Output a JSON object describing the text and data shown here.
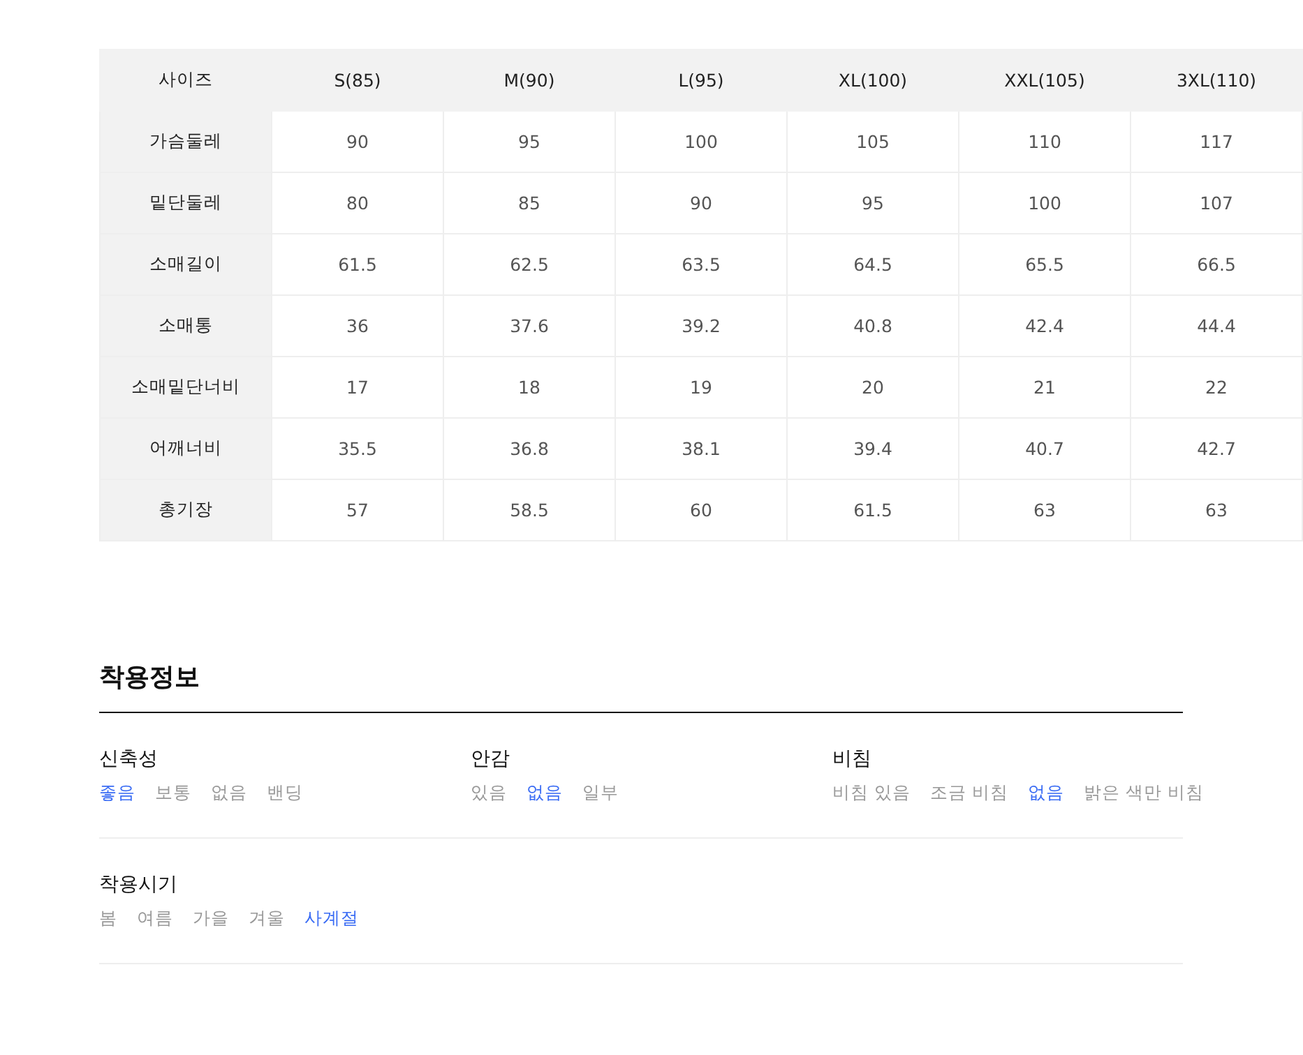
{
  "size_table": {
    "columns": [
      "사이즈",
      "S(85)",
      "M(90)",
      "L(95)",
      "XL(100)",
      "XXL(105)",
      "3XL(110)"
    ],
    "rows": [
      {
        "cells": [
          "가슴둘레",
          "90",
          "95",
          "100",
          "105",
          "110",
          "117"
        ]
      },
      {
        "cells": [
          "밑단둘레",
          "80",
          "85",
          "90",
          "95",
          "100",
          "107"
        ]
      },
      {
        "cells": [
          "소매길이",
          "61.5",
          "62.5",
          "63.5",
          "64.5",
          "65.5",
          "66.5"
        ]
      },
      {
        "cells": [
          "소매통",
          "36",
          "37.6",
          "39.2",
          "40.8",
          "42.4",
          "44.4"
        ]
      },
      {
        "cells": [
          "소매밑단너비",
          "17",
          "18",
          "19",
          "20",
          "21",
          "22"
        ]
      },
      {
        "cells": [
          "어깨너비",
          "35.5",
          "36.8",
          "38.1",
          "39.4",
          "40.7",
          "42.7"
        ]
      },
      {
        "cells": [
          "총기장",
          "57",
          "58.5",
          "60",
          "61.5",
          "63",
          "63"
        ]
      }
    ]
  },
  "fit_info": {
    "title": "착용정보",
    "sections": [
      {
        "groups": [
          {
            "label": "신축성",
            "options": [
              {
                "text": "좋음",
                "selected": true
              },
              {
                "text": "보통",
                "selected": false
              },
              {
                "text": "없음",
                "selected": false
              },
              {
                "text": "밴딩",
                "selected": false
              }
            ]
          },
          {
            "label": "안감",
            "options": [
              {
                "text": "있음",
                "selected": false
              },
              {
                "text": "없음",
                "selected": true
              },
              {
                "text": "일부",
                "selected": false
              }
            ]
          },
          {
            "label": "비침",
            "options": [
              {
                "text": "비침 있음",
                "selected": false
              },
              {
                "text": "조금 비침",
                "selected": false
              },
              {
                "text": "없음",
                "selected": true
              },
              {
                "text": "밝은 색만 비침",
                "selected": false
              }
            ]
          }
        ]
      },
      {
        "groups": [
          {
            "label": "착용시기",
            "options": [
              {
                "text": "봄",
                "selected": false
              },
              {
                "text": "여름",
                "selected": false
              },
              {
                "text": "가을",
                "selected": false
              },
              {
                "text": "겨울",
                "selected": false
              },
              {
                "text": "사계절",
                "selected": true
              }
            ]
          }
        ]
      }
    ]
  }
}
